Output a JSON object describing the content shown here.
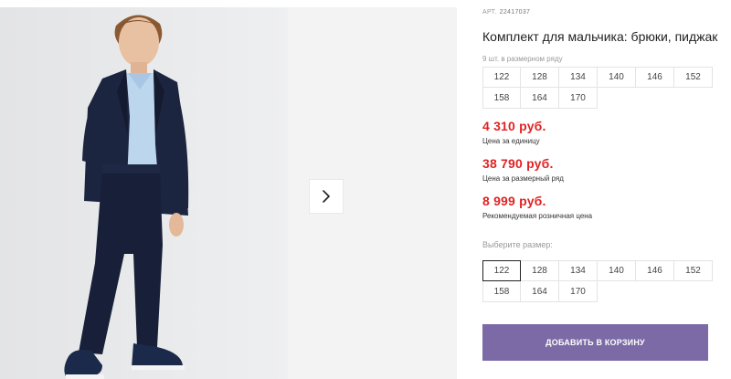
{
  "product": {
    "sku_label": "АРТ.",
    "sku": "22417037",
    "title": "Комплект для мальчика: брюки, пиджак",
    "pack_note": "9 шт. в размерном ряду",
    "pack_sizes": [
      "122",
      "128",
      "134",
      "140",
      "146",
      "152",
      "158",
      "164",
      "170"
    ],
    "prices": [
      {
        "value": "4 310 руб.",
        "note": "Цена за единицу"
      },
      {
        "value": "38 790 руб.",
        "note": "Цена за размерный ряд"
      },
      {
        "value": "8 999 руб.",
        "note": "Рекомендуемая розничная цена"
      }
    ],
    "choose_size_label": "Выберите размер:",
    "select_sizes": [
      "122",
      "128",
      "134",
      "140",
      "146",
      "152",
      "158",
      "164",
      "170"
    ],
    "selected_size": "122",
    "add_to_cart_label": "ДОБАВИТЬ В КОРЗИНУ"
  },
  "gallery": {
    "next_icon": "chevron-right-icon"
  },
  "colors": {
    "price": "#e02323",
    "button": "#7b6aa6",
    "suit": "#1c2540",
    "shirt": "#bcd6ee"
  }
}
